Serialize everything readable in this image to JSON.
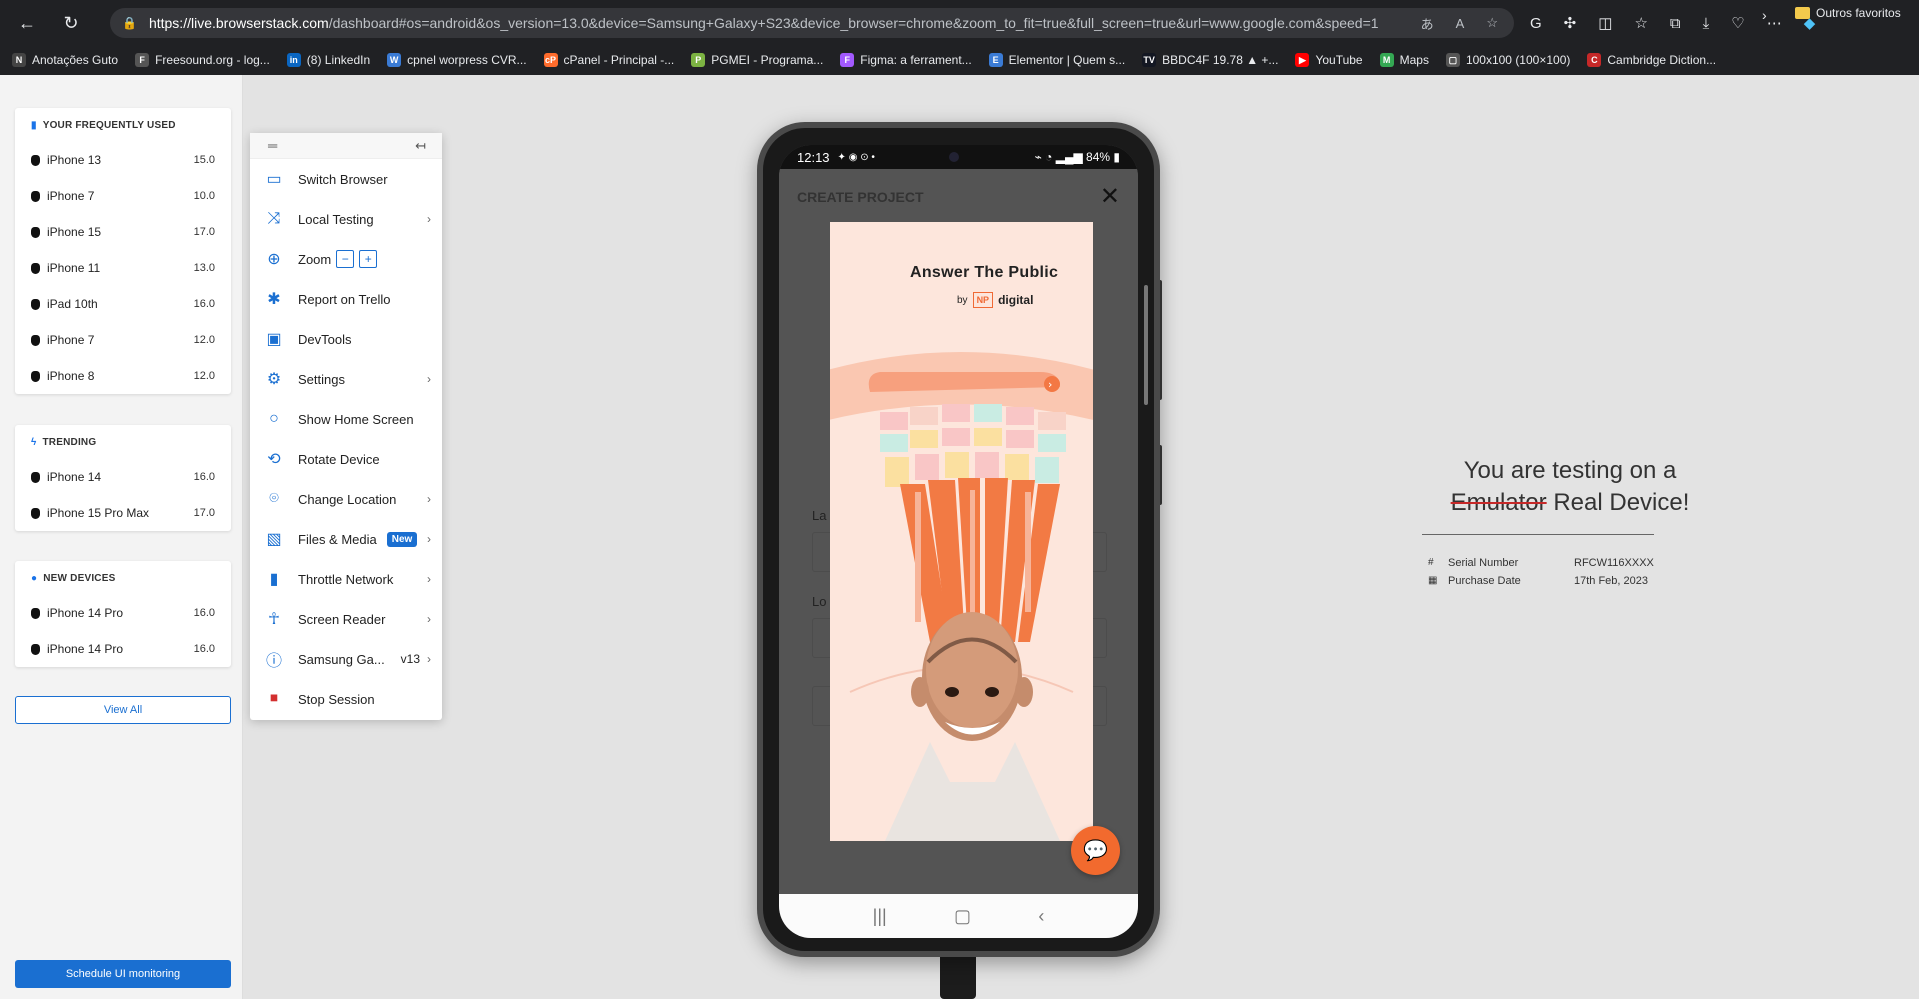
{
  "browser": {
    "url_host": "https://live.browserstack.com",
    "url_rest": "/dashboard#os=android&os_version=13.0&device=Samsung+Galaxy+S23&device_browser=chrome&zoom_to_fit=true&full_screen=true&url=www.google.com&speed=1",
    "bookmarks": [
      {
        "label": "Anotações Guto",
        "icon": "N",
        "color": "#444444"
      },
      {
        "label": "Freesound.org - log...",
        "icon": "F",
        "color": "#555555"
      },
      {
        "label": "(8) LinkedIn",
        "icon": "in",
        "color": "#0a66c2"
      },
      {
        "label": "cpnel worpress CVR...",
        "icon": "W",
        "color": "#3a7bd5"
      },
      {
        "label": "cPanel - Principal -...",
        "icon": "cP",
        "color": "#ff6c2c"
      },
      {
        "label": "PGMEI - Programa...",
        "icon": "P",
        "color": "#7cb342"
      },
      {
        "label": "Figma: a ferrament...",
        "icon": "F",
        "color": "#a259ff"
      },
      {
        "label": "Elementor | Quem s...",
        "icon": "E",
        "color": "#3a7bd5"
      },
      {
        "label": "BBDC4F 19.78 ▲ +...",
        "icon": "TV",
        "color": "#131722"
      },
      {
        "label": "YouTube",
        "icon": "▶",
        "color": "#ff0000"
      },
      {
        "label": "Maps",
        "icon": "M",
        "color": "#34a853"
      },
      {
        "label": "100x100 (100×100)",
        "icon": "▢",
        "color": "#555555"
      },
      {
        "label": "Cambridge Diction...",
        "icon": "C",
        "color": "#c62828"
      }
    ],
    "other_favorites": "Outros favoritos"
  },
  "sidebar": {
    "frequent": {
      "title": "YOUR FREQUENTLY USED",
      "items": [
        {
          "name": "iPhone 13",
          "version": "15.0"
        },
        {
          "name": "iPhone 7",
          "version": "10.0"
        },
        {
          "name": "iPhone 15",
          "version": "17.0"
        },
        {
          "name": "iPhone 11",
          "version": "13.0"
        },
        {
          "name": "iPad 10th",
          "version": "16.0"
        },
        {
          "name": "iPhone 7",
          "version": "12.0"
        },
        {
          "name": "iPhone 8",
          "version": "12.0"
        }
      ]
    },
    "trending": {
      "title": "TRENDING",
      "items": [
        {
          "name": "iPhone 14",
          "version": "16.0"
        },
        {
          "name": "iPhone 15 Pro Max",
          "version": "17.0"
        }
      ]
    },
    "new_devices": {
      "title": "NEW DEVICES",
      "items": [
        {
          "name": "iPhone 14 Pro",
          "version": "16.0"
        },
        {
          "name": "iPhone 14 Pro",
          "version": "16.0"
        }
      ]
    },
    "view_all": "View All",
    "schedule": "Schedule UI monitoring"
  },
  "menu": {
    "switch_browser": "Switch Browser",
    "local_testing": "Local Testing",
    "zoom": "Zoom",
    "zoom_minus": "−",
    "zoom_plus": "+",
    "report_trello": "Report on Trello",
    "devtools": "DevTools",
    "settings": "Settings",
    "show_home": "Show Home Screen",
    "rotate": "Rotate Device",
    "change_location": "Change Location",
    "files_media": "Files & Media",
    "new_badge": "New",
    "throttle": "Throttle Network",
    "screen_reader": "Screen Reader",
    "device_info": "Samsung Ga...",
    "device_version": "v13",
    "stop": "Stop Session"
  },
  "phone": {
    "time": "12:13",
    "battery": "84%",
    "app_title": "CREATE PROJECT",
    "brand_name": "Answer The Public",
    "brand_by": "by",
    "brand_np": "NP",
    "brand_digital": "digital",
    "label_la": "La",
    "label_lo": "Lo"
  },
  "info": {
    "title_line1": "You are testing on a",
    "emulator": "Emulator",
    "real_device": "Real Device!",
    "serial_label": "Serial Number",
    "serial_value": "RFCW116XXXX",
    "purchase_label": "Purchase Date",
    "purchase_value": "17th Feb, 2023"
  }
}
